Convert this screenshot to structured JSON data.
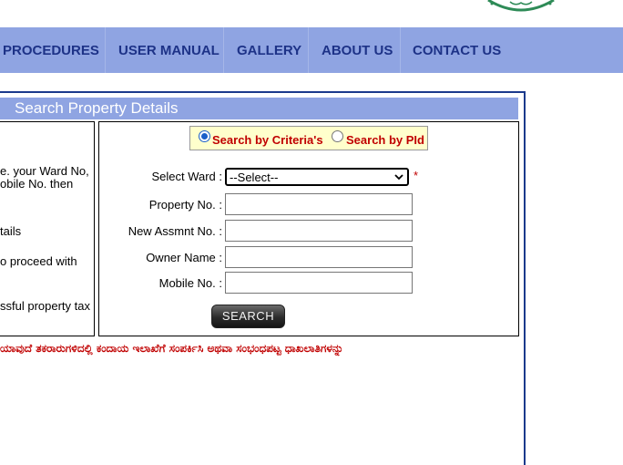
{
  "nav": {
    "items": [
      {
        "label": "PROCEDURES"
      },
      {
        "label": "USER MANUAL"
      },
      {
        "label": "GALLERY"
      },
      {
        "label": "ABOUT US"
      },
      {
        "label": "CONTACT US"
      }
    ]
  },
  "section": {
    "title": "Search Property Details"
  },
  "instructions": {
    "lines": [
      "e. your Ward No,",
      "obile No. then",
      "tails",
      "o proceed with",
      "ssful property tax"
    ]
  },
  "search_mode": {
    "options": [
      "Search by Criteria's",
      "Search by PId"
    ],
    "selected": "Search by Criteria's"
  },
  "form": {
    "ward_label": "Select Ward :",
    "ward_value": "--Select--",
    "required_mark": "*",
    "property_label": "Property No. :",
    "property_value": "",
    "assmnt_label": "New Assmnt No. :",
    "assmnt_value": "",
    "owner_label": "Owner Name :",
    "owner_value": "",
    "mobile_label": "Mobile No. :",
    "mobile_value": ""
  },
  "search_button": {
    "label": "SEARCH"
  },
  "notice": {
    "text": "ಯಾವುದೆ ತಕರಾರುಗಳಿದಲ್ಲಿ ಕಂದಾಯ ಇಲಾಖೆಗೆ ಸಂಪರ್ಕಿಸಿ ಅಥವಾ ಸಂಭಂಧಪಟ್ಟ ಧಾಖಲಾತಿಗಳನ್ನು"
  },
  "colors": {
    "nav_bg": "#8fa4e2",
    "nav_text": "#1d3287",
    "frame_border": "#1b3a8c",
    "accent_red": "#c00000",
    "radio_box_bg": "#ffffcc"
  }
}
